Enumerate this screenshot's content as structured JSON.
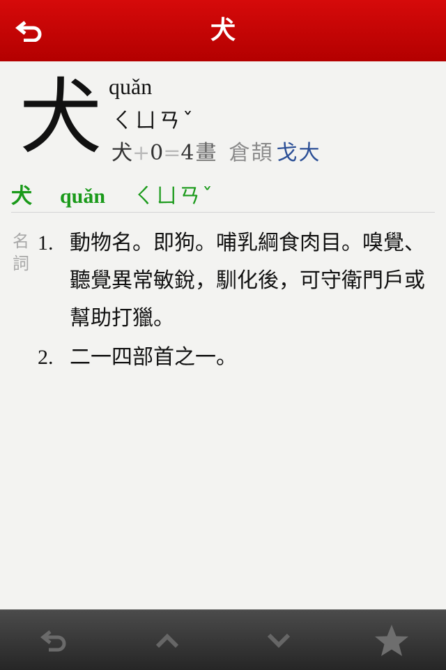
{
  "header": {
    "title": "犬",
    "back_icon": "back-arrow-icon"
  },
  "entry": {
    "character": "犬",
    "pinyin": "quǎn",
    "bopomofo": "ㄑㄩㄢˇ",
    "strokes": {
      "radical": "犬",
      "plus": "+",
      "extra": "0",
      "equals": "=",
      "total": "4",
      "label": "畫"
    },
    "cangjie_label": "倉頡",
    "cangjie_value": "戈大"
  },
  "heteronym": {
    "character": "犬",
    "pinyin": "quǎn",
    "bopomofo": "ㄑㄩㄢˇ"
  },
  "definitions": {
    "part_of_speech": "名詞",
    "items": [
      {
        "num": "1.",
        "text": "動物名。即狗。哺乳綱食肉目。嗅覺、聽覺異常敏銳，馴化後，可守衛門戶或幫助打獵。"
      },
      {
        "num": "2.",
        "text": "二一四部首之一。"
      }
    ]
  },
  "toolbar": {
    "icons": [
      "back-icon",
      "chevron-up-icon",
      "chevron-down-icon",
      "star-icon"
    ]
  },
  "colors": {
    "header_red": "#c80000",
    "headline_green": "#1a9a1a",
    "cangjie_blue": "#2b4f96"
  }
}
